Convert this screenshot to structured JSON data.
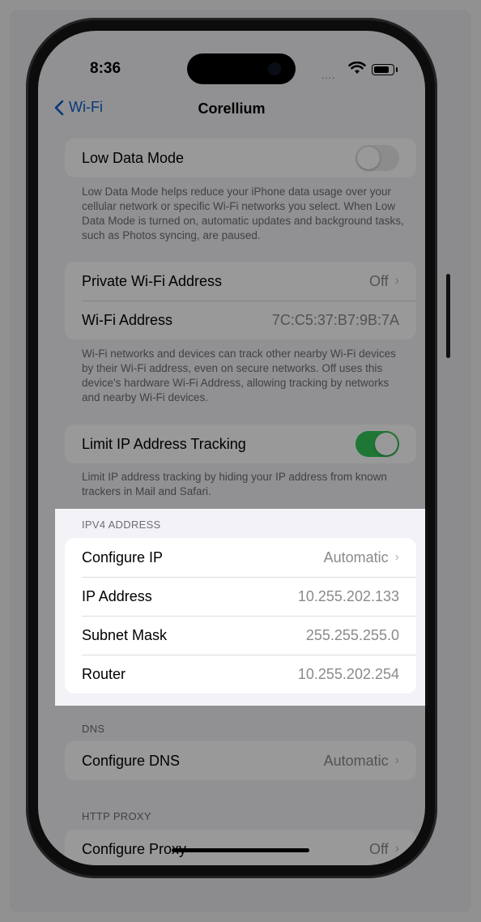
{
  "status_bar": {
    "time": "8:36",
    "signal": "....",
    "wifi_icon": "wifi-icon",
    "battery_icon": "battery-icon"
  },
  "nav": {
    "back_label": "Wi-Fi",
    "title": "Corellium"
  },
  "low_data": {
    "label": "Low Data Mode",
    "enabled": false,
    "footer": "Low Data Mode helps reduce your iPhone data usage over your cellular network or specific Wi-Fi networks you select. When Low Data Mode is turned on, automatic updates and background tasks, such as Photos syncing, are paused."
  },
  "private_address": {
    "private_label": "Private Wi-Fi Address",
    "private_value": "Off",
    "address_label": "Wi-Fi Address",
    "address_value": "7C:C5:37:B7:9B:7A",
    "footer": "Wi-Fi networks and devices can track other nearby Wi-Fi devices by their Wi-Fi address, even on secure networks. Off uses this device's hardware Wi-Fi Address, allowing tracking by networks and nearby Wi-Fi devices."
  },
  "limit_ip": {
    "label": "Limit IP Address Tracking",
    "enabled": true,
    "footer": "Limit IP address tracking by hiding your IP address from known trackers in Mail and Safari."
  },
  "ipv4": {
    "header": "IPV4 ADDRESS",
    "rows": [
      {
        "label": "Configure IP",
        "value": "Automatic"
      },
      {
        "label": "IP Address",
        "value": "10.255.202.133"
      },
      {
        "label": "Subnet Mask",
        "value": "255.255.255.0"
      },
      {
        "label": "Router",
        "value": "10.255.202.254"
      }
    ]
  },
  "dns": {
    "header": "DNS",
    "label": "Configure DNS",
    "value": "Automatic"
  },
  "http_proxy": {
    "header": "HTTP PROXY",
    "label": "Configure Proxy",
    "value": "Off"
  },
  "colors": {
    "accent": "#0a60c8",
    "toggle_on": "#34c759",
    "toggle_off": "#e9e9eb",
    "dim_overlay": "rgba(0,0,0,0.4)"
  }
}
